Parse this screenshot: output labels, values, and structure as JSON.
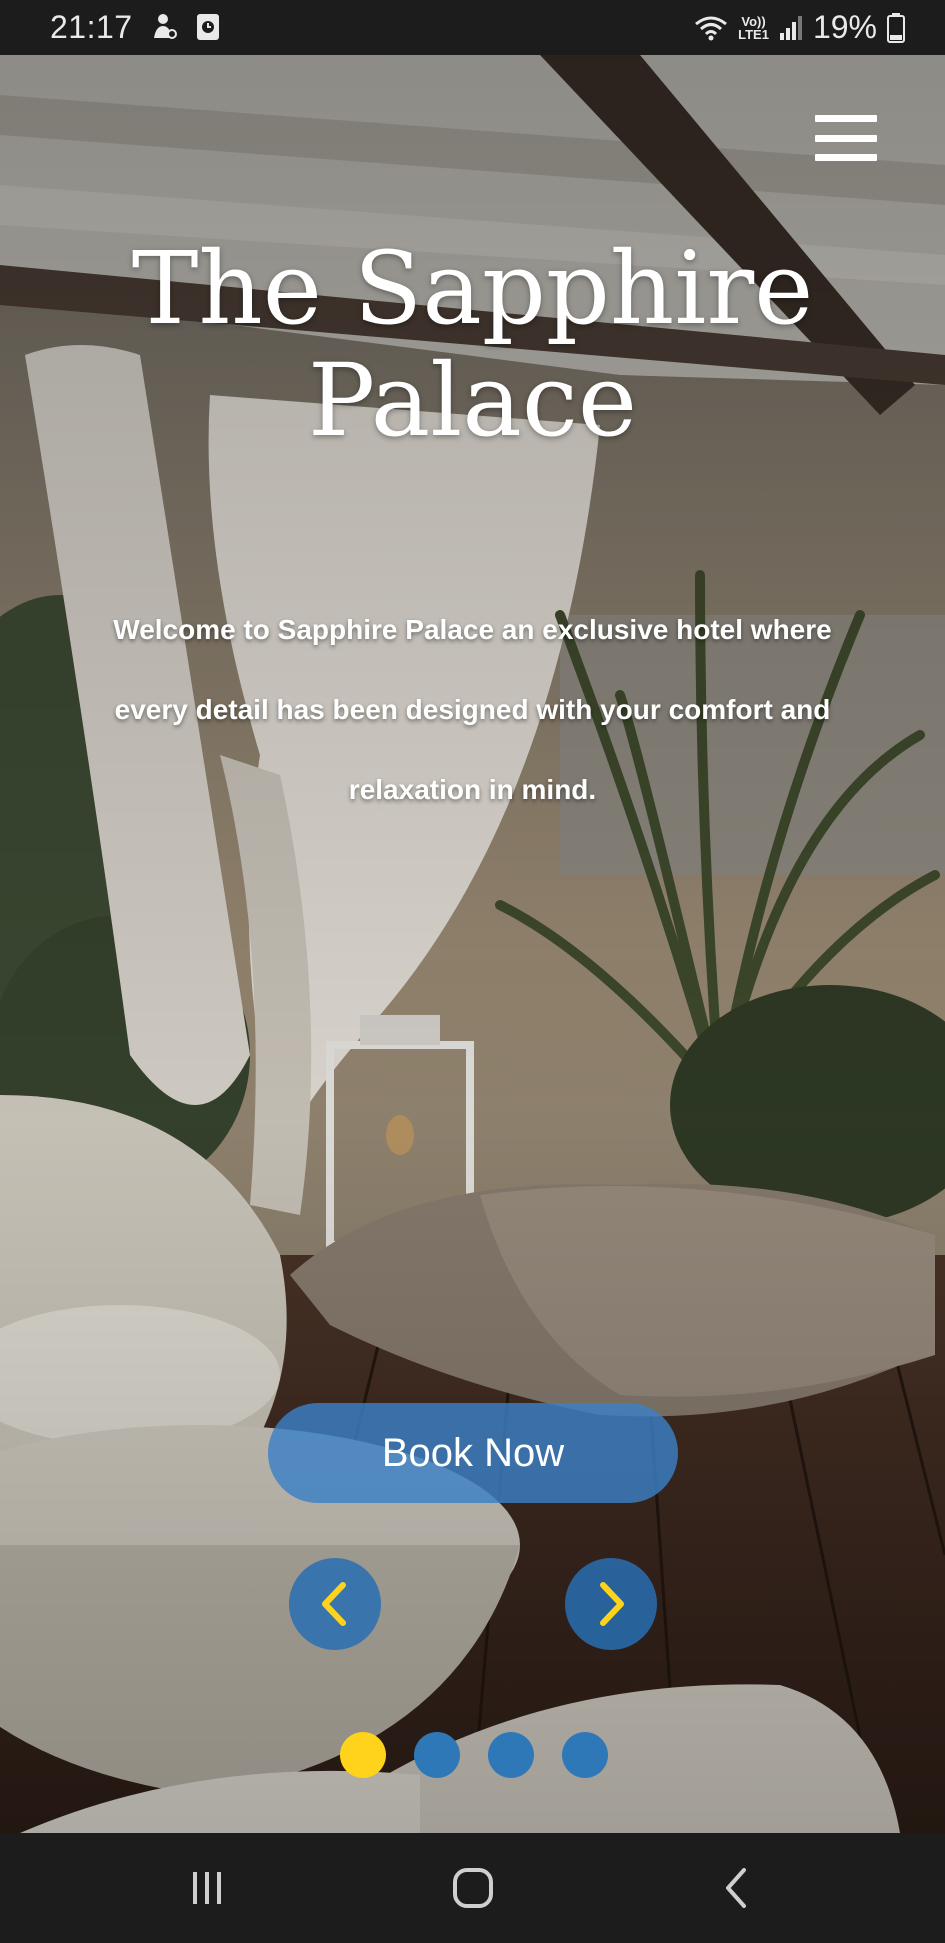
{
  "status_bar": {
    "time": "21:17",
    "battery_text": "19%",
    "network_label_top": "Vo))",
    "network_label_bottom": "LTE1",
    "icons": [
      "person-notification-icon",
      "screen-record-icon",
      "wifi-icon",
      "signal-icon",
      "battery-icon"
    ]
  },
  "hero": {
    "title_line1": "The Sapphire",
    "title_line2": "Palace",
    "intro": "Welcome to Sapphire Palace an exclusive hotel where every detail has been designed with your comfort and relaxation in mind.",
    "book_button_label": "Book Now",
    "carousel": {
      "slide_count": 4,
      "active_index": 0
    }
  },
  "colors": {
    "accent_blue": "#3a80c6",
    "dot_active": "#ffd21c",
    "arrow_chevron": "#ffd21c"
  },
  "nav_bar": {
    "buttons": [
      "recent-apps-icon",
      "home-icon",
      "back-icon"
    ]
  }
}
